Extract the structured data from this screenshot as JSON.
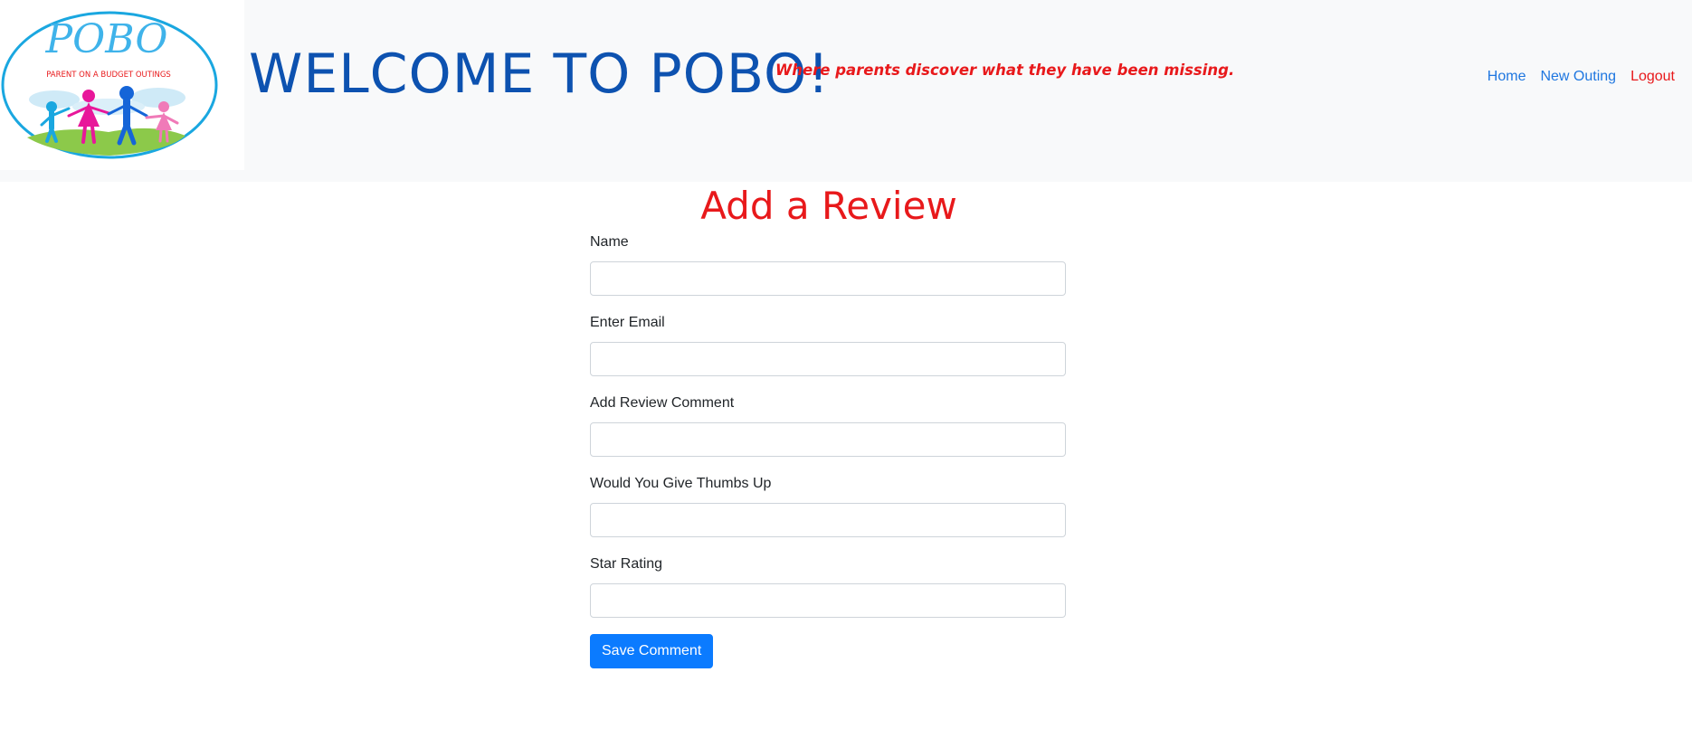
{
  "header": {
    "logo": {
      "title": "POBO",
      "subtitle": "PARENT ON A BUDGET OUTINGS"
    },
    "site_title": "WELCOME TO POBO!",
    "tagline": "Where parents discover what they have been missing.",
    "nav": {
      "home": "Home",
      "new_outing": "New Outing",
      "logout": "Logout"
    }
  },
  "main": {
    "heading": "Add a Review",
    "fields": {
      "name": {
        "label": "Name",
        "value": "",
        "placeholder": ""
      },
      "email": {
        "label": "Enter Email",
        "value": "",
        "placeholder": ""
      },
      "comment": {
        "label": "Add Review Comment",
        "value": "",
        "placeholder": ""
      },
      "thumbs": {
        "label": "Would You Give Thumbs Up",
        "value": "",
        "placeholder": ""
      },
      "rating": {
        "label": "Star Rating",
        "value": "",
        "placeholder": ""
      }
    },
    "save_label": "Save Comment"
  },
  "colors": {
    "brand_blue": "#0d52b0",
    "link_blue": "#1f77e0",
    "accent_red": "#e8191b",
    "button_blue": "#0b7bff",
    "navbar_bg": "#f8f9fa"
  }
}
